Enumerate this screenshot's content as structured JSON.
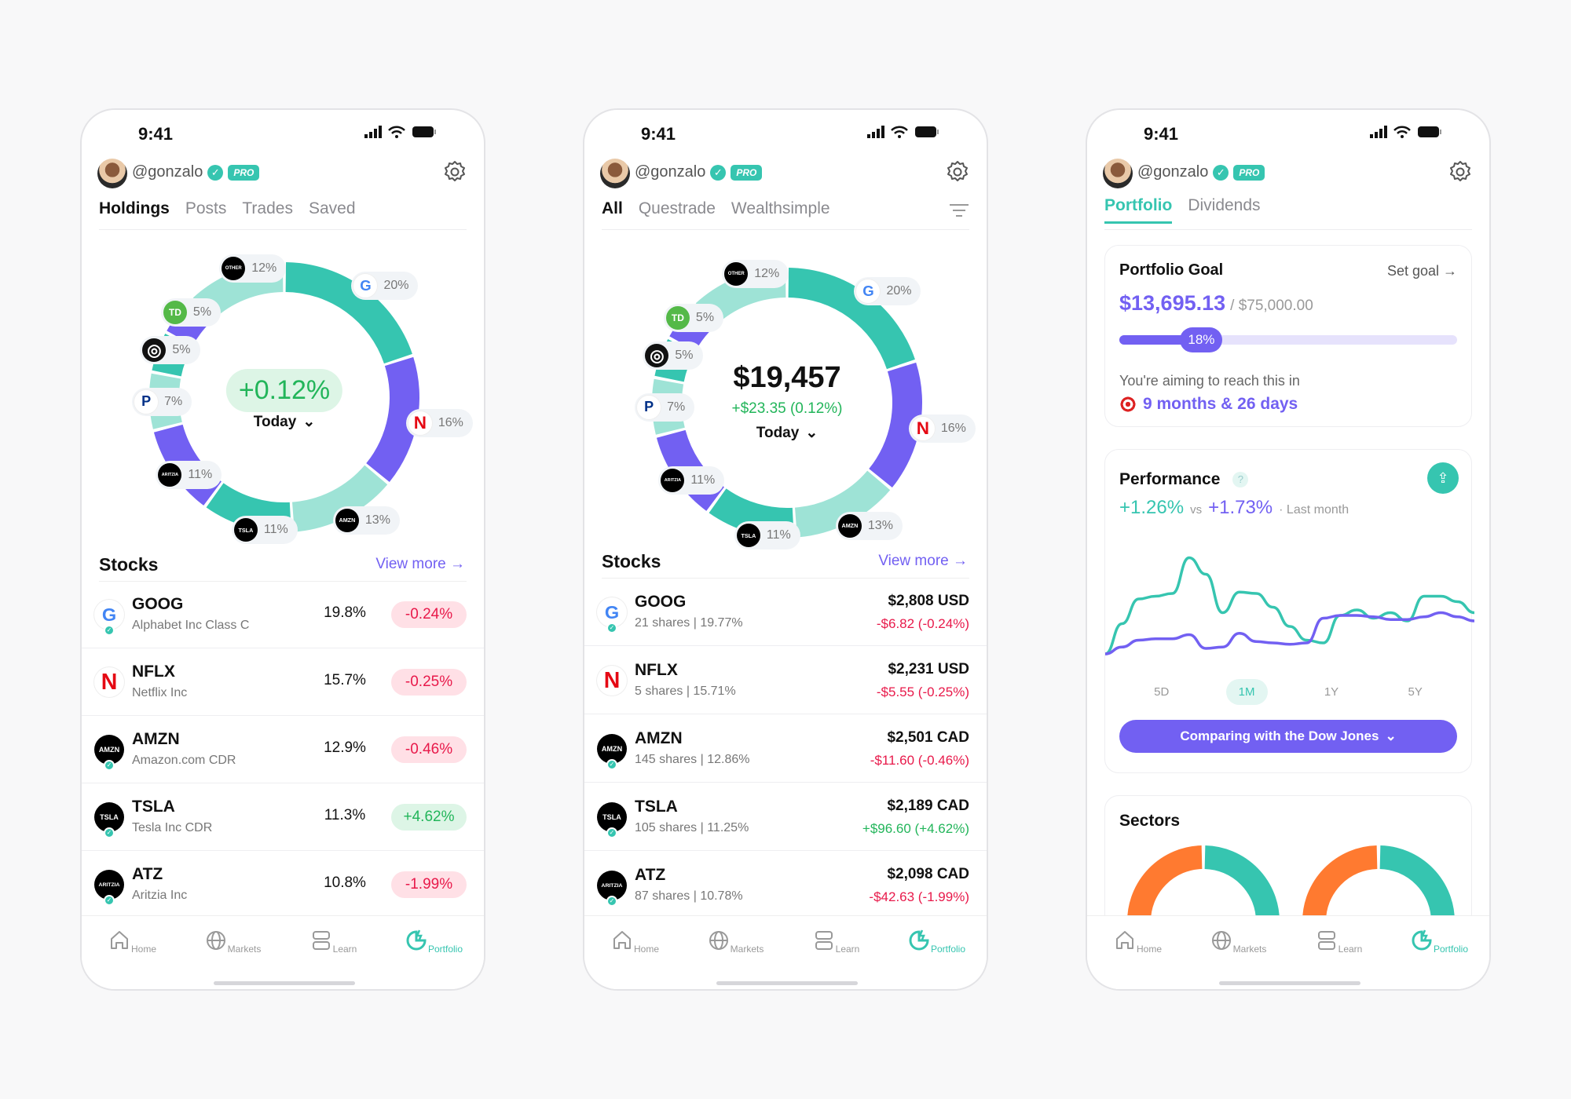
{
  "colors": {
    "teal": "#36C5B0",
    "purple": "#7260F2",
    "light_teal": "#9EE3D6",
    "green": "#22B55A",
    "red": "#E8194A",
    "orange": "#FF7A30"
  },
  "status": {
    "time": "9:41"
  },
  "profile": {
    "handle": "@gonzalo",
    "badge": "PRO"
  },
  "nav": [
    {
      "label": "Home",
      "icon": "home-icon"
    },
    {
      "label": "Markets",
      "icon": "globe-icon"
    },
    {
      "label": "Learn",
      "icon": "learn-icon"
    },
    {
      "label": "Portfolio",
      "icon": "portfolio-icon",
      "active": true
    }
  ],
  "allocation": [
    {
      "name": "GOOG",
      "pct": 20,
      "label": "20%",
      "color": "teal",
      "logo": "google"
    },
    {
      "name": "NFLX",
      "pct": 16,
      "label": "16%",
      "color": "purple",
      "logo": "netflix"
    },
    {
      "name": "AMZN",
      "pct": 13,
      "label": "13%",
      "color": "light_teal",
      "logo": "amzn",
      "logo_text": "AMZN"
    },
    {
      "name": "TSLA",
      "pct": 11,
      "label": "11%",
      "color": "teal",
      "logo": "tsla",
      "logo_text": "TSLA"
    },
    {
      "name": "ATZ",
      "pct": 11,
      "label": "11%",
      "color": "purple",
      "logo": "aritzia",
      "logo_text": "ARITZIA"
    },
    {
      "name": "PYPL",
      "pct": 7,
      "label": "7%",
      "color": "light_teal",
      "logo": "paypal"
    },
    {
      "name": "RING",
      "pct": 5,
      "label": "5%",
      "color": "teal",
      "logo": "ring"
    },
    {
      "name": "TD",
      "pct": 5,
      "label": "5%",
      "color": "purple",
      "logo": "td"
    },
    {
      "name": "OTHER",
      "pct": 12,
      "label": "12%",
      "color": "light_teal",
      "logo": "other",
      "logo_text": "OTHER"
    }
  ],
  "screen1": {
    "tabs": [
      "Holdings",
      "Posts",
      "Trades",
      "Saved"
    ],
    "active_tab": 0,
    "center_value": "+0.12%",
    "period": "Today",
    "section": "Stocks",
    "view_more": "View more →",
    "stocks": [
      {
        "ticker": "GOOG",
        "name": "Alphabet Inc Class C",
        "weight": "19.8%",
        "change": "-0.24%",
        "up": false,
        "logo": "google"
      },
      {
        "ticker": "NFLX",
        "name": "Netflix Inc",
        "weight": "15.7%",
        "change": "-0.25%",
        "up": false,
        "logo": "netflix"
      },
      {
        "ticker": "AMZN",
        "name": "Amazon.com CDR",
        "weight": "12.9%",
        "change": "-0.46%",
        "up": false,
        "logo": "amzn",
        "logo_text": "AMZN"
      },
      {
        "ticker": "TSLA",
        "name": "Tesla Inc CDR",
        "weight": "11.3%",
        "change": "+4.62%",
        "up": true,
        "logo": "tsla",
        "logo_text": "TSLA"
      },
      {
        "ticker": "ATZ",
        "name": "Aritzia Inc",
        "weight": "10.8%",
        "change": "-1.99%",
        "up": false,
        "logo": "aritzia",
        "logo_text": "ARITZIA"
      }
    ]
  },
  "screen2": {
    "tabs": [
      "All",
      "Questrade",
      "Wealthsimple"
    ],
    "active_tab": 0,
    "center_value": "$19,457",
    "center_change": "+$23.35 (0.12%)",
    "period": "Today",
    "section": "Stocks",
    "view_more": "View more →",
    "stocks": [
      {
        "ticker": "GOOG",
        "detail": "21 shares | 19.77%",
        "price": "$2,808 USD",
        "change": "-$6.82 (-0.24%)",
        "up": false,
        "logo": "google"
      },
      {
        "ticker": "NFLX",
        "detail": "5 shares | 15.71%",
        "price": "$2,231 USD",
        "change": "-$5.55 (-0.25%)",
        "up": false,
        "logo": "netflix"
      },
      {
        "ticker": "AMZN",
        "detail": "145 shares | 12.86%",
        "price": "$2,501 CAD",
        "change": "-$11.60 (-0.46%)",
        "up": false,
        "logo": "amzn",
        "logo_text": "AMZN"
      },
      {
        "ticker": "TSLA",
        "detail": "105 shares | 11.25%",
        "price": "$2,189 CAD",
        "change": "+$96.60 (+4.62%)",
        "up": true,
        "logo": "tsla",
        "logo_text": "TSLA"
      },
      {
        "ticker": "ATZ",
        "detail": "87 shares | 10.78%",
        "price": "$2,098 CAD",
        "change": "-$42.63 (-1.99%)",
        "up": false,
        "logo": "aritzia",
        "logo_text": "ARITZIA"
      }
    ]
  },
  "screen3": {
    "tabs": [
      "Portfolio",
      "Dividends"
    ],
    "active_tab": 0,
    "goal": {
      "title": "Portfolio Goal",
      "set_goal": "Set goal →",
      "current": "$13,695.13",
      "target": "/ $75,000.00",
      "progress_pct": 18,
      "progress_label": "18%",
      "aim_text": "You're aiming to reach this in",
      "eta": "9 months & 26 days"
    },
    "performance": {
      "title": "Performance",
      "help": "?",
      "portfolio_return": "+1.26%",
      "vs": "vs",
      "benchmark_return": "+1.73%",
      "period_text": "· Last month",
      "periods": [
        "5D",
        "1M",
        "1Y",
        "5Y"
      ],
      "active_period": 1,
      "compare_button": "Comparing with the Dow Jones"
    },
    "sectors": {
      "title": "Sectors"
    }
  },
  "chart_data": {
    "type": "line",
    "title": "",
    "xlabel": "",
    "ylabel": "",
    "grid": false,
    "series": [
      {
        "color": "#36C5B0",
        "values": [
          0,
          22,
          40,
          42,
          44,
          70,
          58,
          30,
          45,
          44,
          34,
          20,
          10,
          8,
          28,
          32,
          26,
          30,
          24,
          42,
          42,
          38,
          30
        ]
      },
      {
        "color": "#7260F2",
        "values": [
          0,
          5,
          10,
          11,
          11,
          14,
          4,
          5,
          15,
          9,
          8,
          7,
          8,
          26,
          28,
          28,
          27,
          25,
          25,
          27,
          30,
          27,
          24
        ]
      }
    ]
  }
}
